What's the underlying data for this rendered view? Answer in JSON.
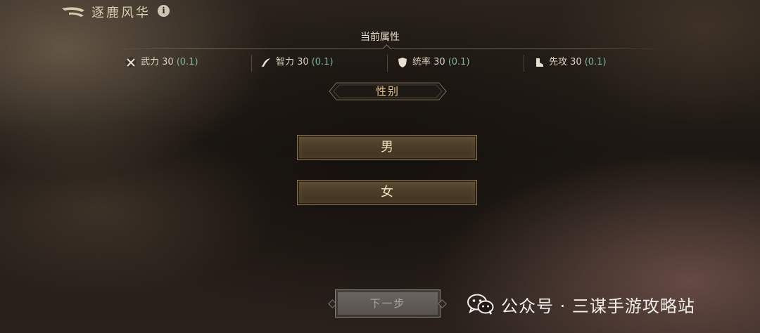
{
  "header": {
    "title": "逐鹿风华",
    "back_icon": "back-arrow-icon",
    "info_icon": "info-icon",
    "info_glyph": "i"
  },
  "attributes": {
    "title": "当前属性",
    "items": [
      {
        "icon": "crossed-swords-icon",
        "name": "武力",
        "value": "30",
        "delta": "(0.1)"
      },
      {
        "icon": "quill-icon",
        "name": "智力",
        "value": "30",
        "delta": "(0.1)"
      },
      {
        "icon": "shield-icon",
        "name": "统率",
        "value": "30",
        "delta": "(0.1)"
      },
      {
        "icon": "boot-icon",
        "name": "先攻",
        "value": "30",
        "delta": "(0.1)"
      }
    ],
    "delta_color": "#7fb49a"
  },
  "gender": {
    "label": "性别",
    "options": [
      "男",
      "女"
    ]
  },
  "next_button": {
    "label": "下一步",
    "enabled": false
  },
  "watermark": {
    "icon": "wechat-icon",
    "text": "公众号 · 三谋手游攻略站"
  },
  "colors": {
    "accent_gold": "#e9c98c",
    "button_fill": "#4a3c28",
    "button_border": "#8e7650"
  }
}
